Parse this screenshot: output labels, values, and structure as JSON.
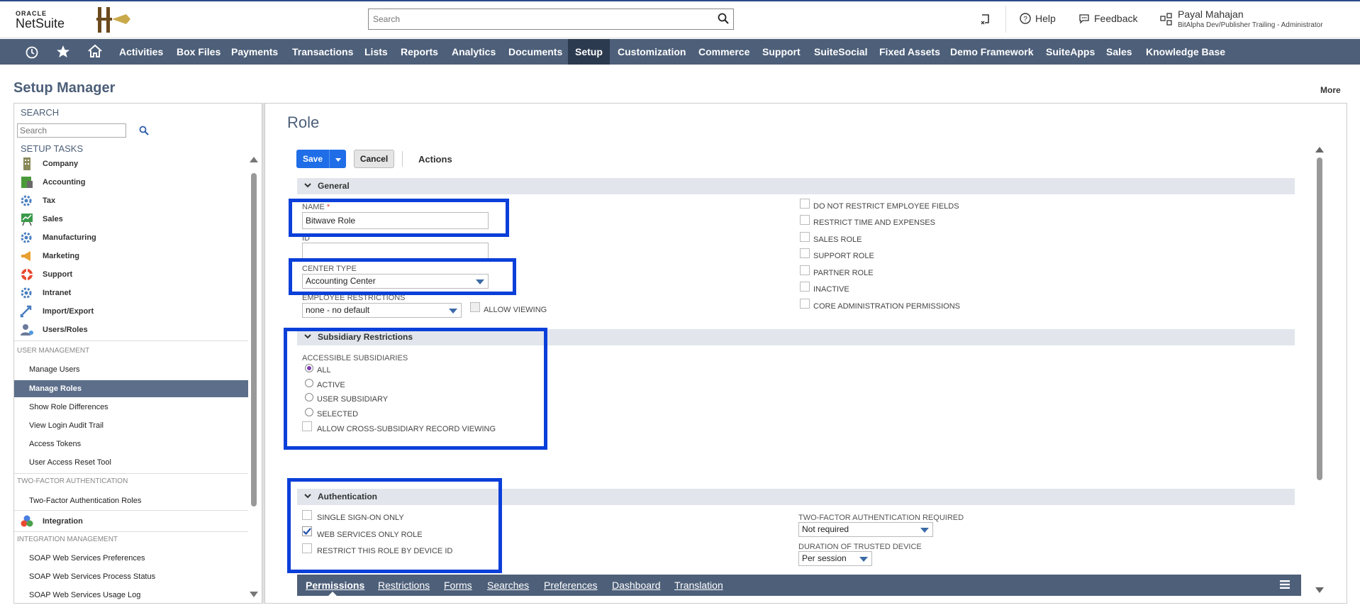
{
  "header": {
    "logo_oracle": "ORACLE",
    "logo_netsuite": "NetSuite",
    "search_placeholder": "Search",
    "help": "Help",
    "feedback": "Feedback",
    "user_name": "Payal Mahajan",
    "user_role": "BitAlpha Dev/Publisher Trailing - Administrator"
  },
  "nav": {
    "items": [
      "Activities",
      "Box Files",
      "Payments",
      "Transactions",
      "Lists",
      "Reports",
      "Analytics",
      "Documents",
      "Setup",
      "Customization",
      "Commerce",
      "Support",
      "SuiteSocial",
      "Fixed Assets",
      "Demo Framework",
      "SuiteApps",
      "Sales",
      "Knowledge Base"
    ],
    "active": "Setup"
  },
  "page": {
    "title": "Setup Manager",
    "more": "More"
  },
  "left_panel": {
    "search_header": "SEARCH",
    "search_placeholder": "Search",
    "tasks_header": "SETUP TASKS",
    "tasks": [
      "Company",
      "Accounting",
      "Tax",
      "Sales",
      "Manufacturing",
      "Marketing",
      "Support",
      "Intranet",
      "Import/Export",
      "Users/Roles"
    ],
    "user_mgmt_label": "USER MANAGEMENT",
    "user_mgmt_items": [
      "Manage Users",
      "Manage Roles",
      "Show Role Differences",
      "View Login Audit Trail",
      "Access Tokens",
      "User Access Reset Tool"
    ],
    "active_item": "Manage Roles",
    "twofa_label": "TWO-FACTOR AUTHENTICATION",
    "twofa_items": [
      "Two-Factor Authentication Roles"
    ],
    "integration": "Integration",
    "integration_label": "INTEGRATION MANAGEMENT",
    "integration_items": [
      "SOAP Web Services Preferences",
      "SOAP Web Services Process Status",
      "SOAP Web Services Usage Log"
    ]
  },
  "form": {
    "title": "Role",
    "save": "Save",
    "cancel": "Cancel",
    "actions": "Actions",
    "general": "General",
    "name_label": "NAME",
    "name_required": "*",
    "name_value": "Bitwave Role",
    "id_label": "ID",
    "id_value": "",
    "center_type_label": "CENTER TYPE",
    "center_type_value": "Accounting Center",
    "emp_restrictions_label": "EMPLOYEE RESTRICTIONS",
    "emp_restrictions_value": "none - no default",
    "allow_viewing": "ALLOW VIEWING",
    "right_checks": [
      "DO NOT RESTRICT EMPLOYEE FIELDS",
      "RESTRICT TIME AND EXPENSES",
      "SALES ROLE",
      "SUPPORT ROLE",
      "PARTNER ROLE",
      "INACTIVE",
      "CORE ADMINISTRATION PERMISSIONS"
    ],
    "subsidiary": "Subsidiary Restrictions",
    "accessible_label": "ACCESSIBLE SUBSIDIARIES",
    "radios": [
      "ALL",
      "ACTIVE",
      "USER SUBSIDIARY",
      "SELECTED"
    ],
    "radio_selected": "ALL",
    "cross_sub": "ALLOW CROSS-SUBSIDIARY RECORD VIEWING",
    "authentication": "Authentication",
    "auth_checks": [
      "SINGLE SIGN-ON ONLY",
      "WEB SERVICES ONLY ROLE",
      "RESTRICT THIS ROLE BY DEVICE ID"
    ],
    "auth_checked": "WEB SERVICES ONLY ROLE",
    "twofa_required_label": "TWO-FACTOR AUTHENTICATION REQUIRED",
    "twofa_required_value": "Not required",
    "trusted_label": "DURATION OF TRUSTED DEVICE",
    "trusted_value": "Per session",
    "tabs": [
      "Permissions",
      "Restrictions",
      "Forms",
      "Searches",
      "Preferences",
      "Dashboard",
      "Translation"
    ],
    "active_tab": "Permissions"
  },
  "colors": {
    "nav_bg": "#4d5f79",
    "primary_button": "#1f6ee8",
    "highlight_box": "#0b3fd9"
  }
}
